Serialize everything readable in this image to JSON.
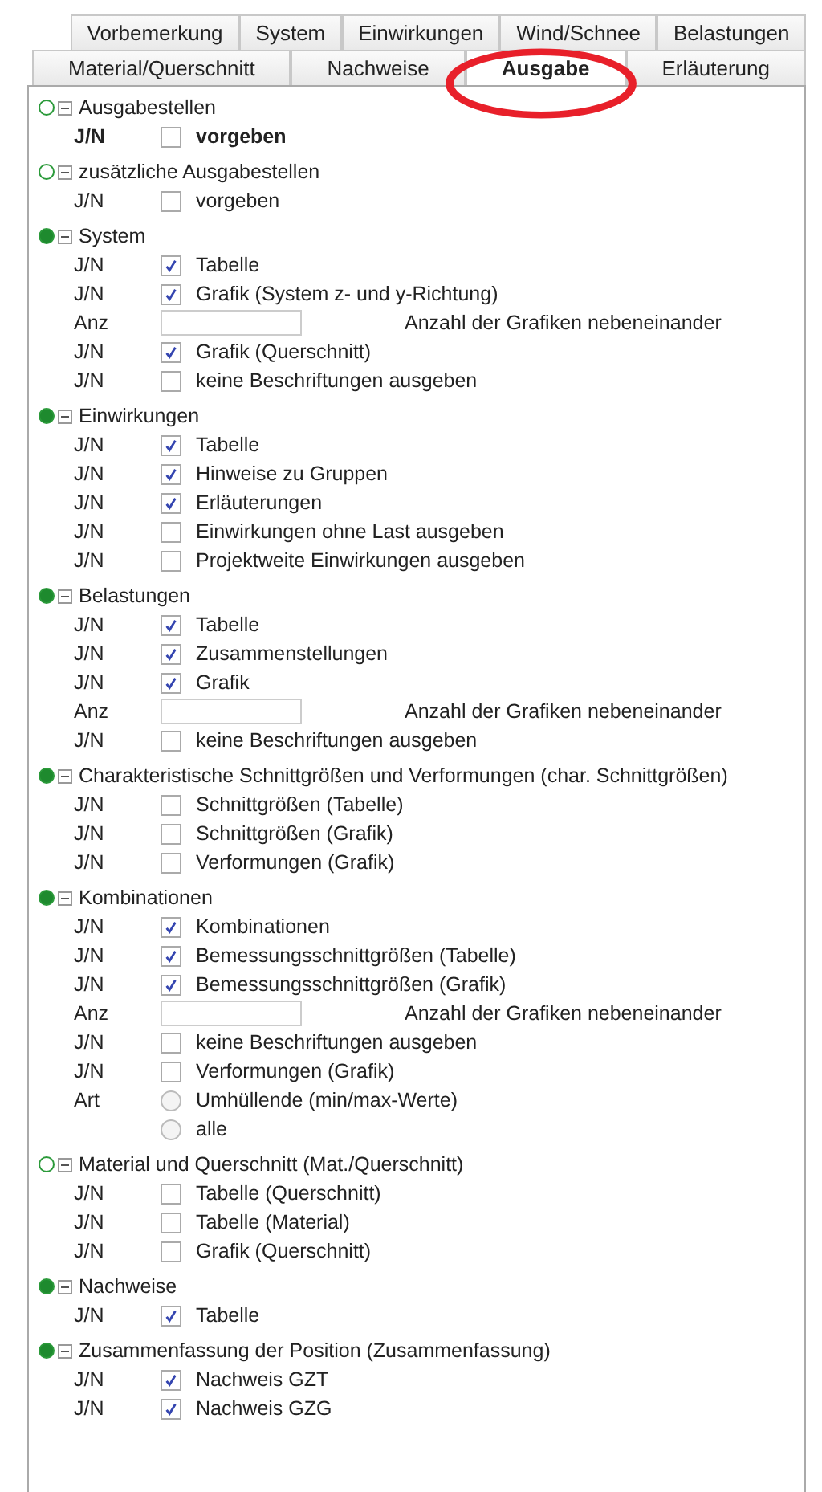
{
  "tabs_row_1": [
    {
      "label": "Vorbemerkung",
      "selected": false
    },
    {
      "label": "System",
      "selected": false
    },
    {
      "label": "Einwirkungen",
      "selected": false
    },
    {
      "label": "Wind/Schnee",
      "selected": false
    },
    {
      "label": "Belastungen",
      "selected": false
    }
  ],
  "tabs_row_2": [
    {
      "label": "Material/Querschnitt",
      "selected": false
    },
    {
      "label": "Nachweise",
      "selected": false
    },
    {
      "label": "Ausgabe",
      "selected": true
    },
    {
      "label": "Erläuterung",
      "selected": false
    }
  ],
  "sections": [
    {
      "title": "Ausgabestellen",
      "active": false,
      "expanded": true,
      "items": [
        {
          "kind": "checkbox",
          "label": "J/N",
          "text": "vorgeben",
          "checked": false,
          "emphasis": true
        }
      ]
    },
    {
      "title": "zusätzliche Ausgabestellen",
      "active": false,
      "expanded": true,
      "items": [
        {
          "kind": "checkbox",
          "label": "J/N",
          "text": "vorgeben",
          "checked": false
        }
      ]
    },
    {
      "title": "System",
      "active": true,
      "expanded": true,
      "items": [
        {
          "kind": "checkbox",
          "label": "J/N",
          "text": "Tabelle",
          "checked": true
        },
        {
          "kind": "checkbox",
          "label": "J/N",
          "text": "Grafik (System z- und y-Richtung)",
          "checked": true
        },
        {
          "kind": "number",
          "label": "Anz",
          "text": "Anzahl der Grafiken nebeneinander"
        },
        {
          "kind": "checkbox",
          "label": "J/N",
          "text": "Grafik (Querschnitt)",
          "checked": true
        },
        {
          "kind": "checkbox",
          "label": "J/N",
          "text": "keine Beschriftungen ausgeben",
          "checked": false
        }
      ]
    },
    {
      "title": "Einwirkungen",
      "active": true,
      "expanded": true,
      "items": [
        {
          "kind": "checkbox",
          "label": "J/N",
          "text": "Tabelle",
          "checked": true
        },
        {
          "kind": "checkbox",
          "label": "J/N",
          "text": "Hinweise zu Gruppen",
          "checked": true
        },
        {
          "kind": "checkbox",
          "label": "J/N",
          "text": "Erläuterungen",
          "checked": true
        },
        {
          "kind": "checkbox",
          "label": "J/N",
          "text": "Einwirkungen ohne Last ausgeben",
          "checked": false
        },
        {
          "kind": "checkbox",
          "label": "J/N",
          "text": "Projektweite Einwirkungen ausgeben",
          "checked": false
        }
      ]
    },
    {
      "title": "Belastungen",
      "active": true,
      "expanded": true,
      "items": [
        {
          "kind": "checkbox",
          "label": "J/N",
          "text": "Tabelle",
          "checked": true
        },
        {
          "kind": "checkbox",
          "label": "J/N",
          "text": "Zusammenstellungen",
          "checked": true
        },
        {
          "kind": "checkbox",
          "label": "J/N",
          "text": "Grafik",
          "checked": true
        },
        {
          "kind": "number",
          "label": "Anz",
          "text": "Anzahl der Grafiken nebeneinander"
        },
        {
          "kind": "checkbox",
          "label": "J/N",
          "text": "keine Beschriftungen ausgeben",
          "checked": false
        }
      ]
    },
    {
      "title": "Charakteristische Schnittgrößen und Verformungen (char. Schnittgrößen)",
      "active": true,
      "expanded": true,
      "items": [
        {
          "kind": "checkbox",
          "label": "J/N",
          "text": "Schnittgrößen (Tabelle)",
          "checked": false
        },
        {
          "kind": "checkbox",
          "label": "J/N",
          "text": "Schnittgrößen (Grafik)",
          "checked": false
        },
        {
          "kind": "checkbox",
          "label": "J/N",
          "text": "Verformungen (Grafik)",
          "checked": false
        }
      ]
    },
    {
      "title": "Kombinationen",
      "active": true,
      "expanded": true,
      "items": [
        {
          "kind": "checkbox",
          "label": "J/N",
          "text": "Kombinationen",
          "checked": true
        },
        {
          "kind": "checkbox",
          "label": "J/N",
          "text": "Bemessungsschnittgrößen (Tabelle)",
          "checked": true
        },
        {
          "kind": "checkbox",
          "label": "J/N",
          "text": "Bemessungsschnittgrößen (Grafik)",
          "checked": true
        },
        {
          "kind": "number",
          "label": "Anz",
          "text": "Anzahl der Grafiken nebeneinander"
        },
        {
          "kind": "checkbox",
          "label": "J/N",
          "text": "keine Beschriftungen ausgeben",
          "checked": false
        },
        {
          "kind": "checkbox",
          "label": "J/N",
          "text": "Verformungen (Grafik)",
          "checked": false
        },
        {
          "kind": "radio",
          "label": "Art",
          "text": "Umhüllende (min/max-Werte)",
          "selected": false
        },
        {
          "kind": "radio",
          "text": "alle",
          "selected": false
        }
      ]
    },
    {
      "title": "Material und Querschnitt (Mat./Querschnitt)",
      "active": false,
      "expanded": true,
      "items": [
        {
          "kind": "checkbox",
          "label": "J/N",
          "text": "Tabelle (Querschnitt)",
          "checked": false
        },
        {
          "kind": "checkbox",
          "label": "J/N",
          "text": "Tabelle (Material)",
          "checked": false
        },
        {
          "kind": "checkbox",
          "label": "J/N",
          "text": "Grafik (Querschnitt)",
          "checked": false
        }
      ]
    },
    {
      "title": "Nachweise",
      "active": true,
      "expanded": true,
      "items": [
        {
          "kind": "checkbox",
          "label": "J/N",
          "text": "Tabelle",
          "checked": true
        }
      ]
    },
    {
      "title": "Zusammenfassung der Position (Zusammenfassung)",
      "active": true,
      "expanded": true,
      "items": [
        {
          "kind": "checkbox",
          "label": "J/N",
          "text": "Nachweis GZT",
          "checked": true
        },
        {
          "kind": "checkbox",
          "label": "J/N",
          "text": "Nachweis GZG",
          "checked": true
        }
      ]
    }
  ]
}
